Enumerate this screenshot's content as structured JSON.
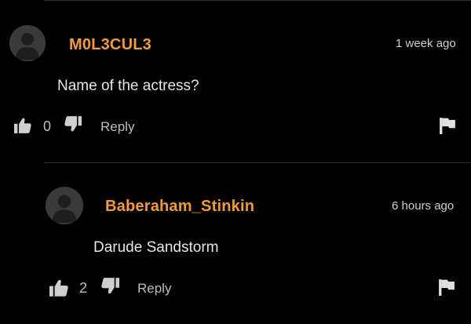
{
  "comment": {
    "username": "M0L3CUL3",
    "timestamp": "1 week ago",
    "text": "Name of the actress?",
    "like_count": "0",
    "reply_label": "Reply"
  },
  "reply": {
    "username": "Baberaham_Stinkin",
    "timestamp": "6 hours ago",
    "text": "Darude Sandstorm",
    "like_count": "2",
    "reply_label": "Reply"
  },
  "icons": {
    "avatar": "avatar-placeholder-icon",
    "like": "thumbs-up-icon",
    "dislike": "thumbs-down-icon",
    "report": "flag-icon"
  },
  "colors": {
    "background": "#000000",
    "username": "#f19a3e",
    "text": "#e6e6e6",
    "muted": "#bdbdbd",
    "divider": "#2b2b2b"
  }
}
